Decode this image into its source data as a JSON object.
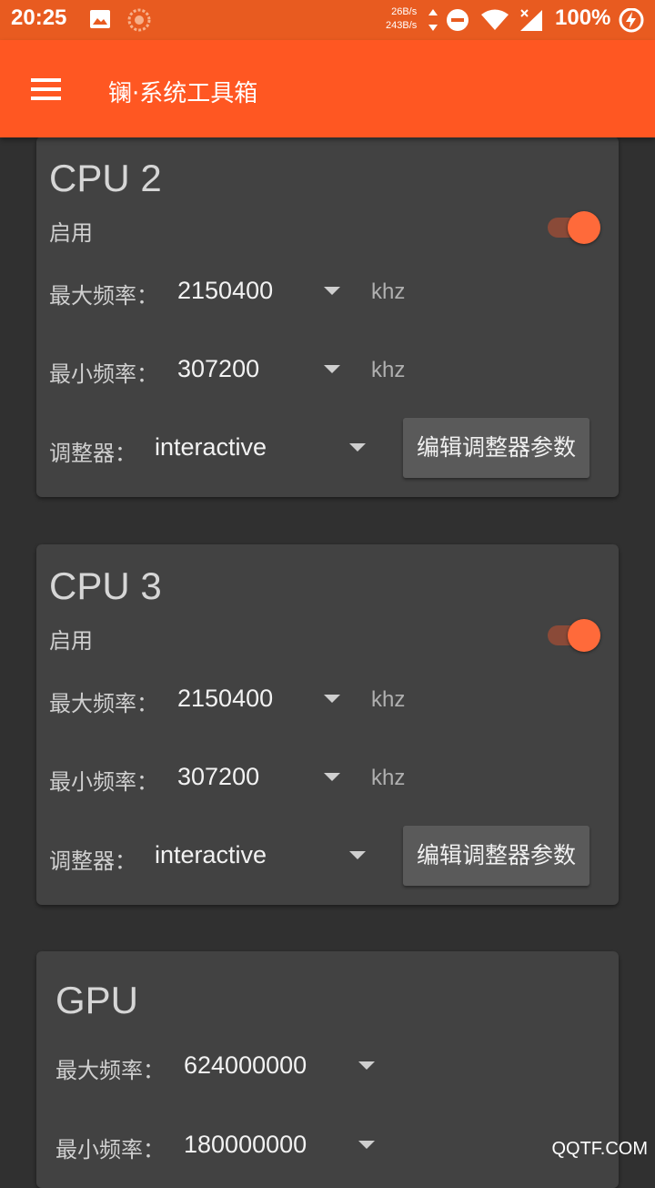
{
  "status_bar": {
    "time": "20:25",
    "net_up": "26B/s",
    "net_down": "243B/s",
    "battery": "100%"
  },
  "app_bar": {
    "title": "镧·系统工具箱"
  },
  "cpu_cards": [
    {
      "title": "CPU 2",
      "enable_label": "启用",
      "enabled": true,
      "max_label": "最大频率：",
      "max_value": "2150400",
      "min_label": "最小频率：",
      "min_value": "307200",
      "unit": "khz",
      "governor_label": "调整器：",
      "governor_value": "interactive",
      "edit_button": "编辑调整器参数"
    },
    {
      "title": "CPU 3",
      "enable_label": "启用",
      "enabled": true,
      "max_label": "最大频率：",
      "max_value": "2150400",
      "min_label": "最小频率：",
      "min_value": "307200",
      "unit": "khz",
      "governor_label": "调整器：",
      "governor_value": "interactive",
      "edit_button": "编辑调整器参数"
    }
  ],
  "gpu_card": {
    "title": "GPU",
    "max_label": "最大频率：",
    "max_value": "624000000",
    "min_label": "最小频率：",
    "min_value": "180000000"
  },
  "watermark": "QQTF.COM",
  "colors": {
    "accent": "#ff5722",
    "status_bar": "#e85b20",
    "card": "#424242",
    "background": "#303030"
  }
}
